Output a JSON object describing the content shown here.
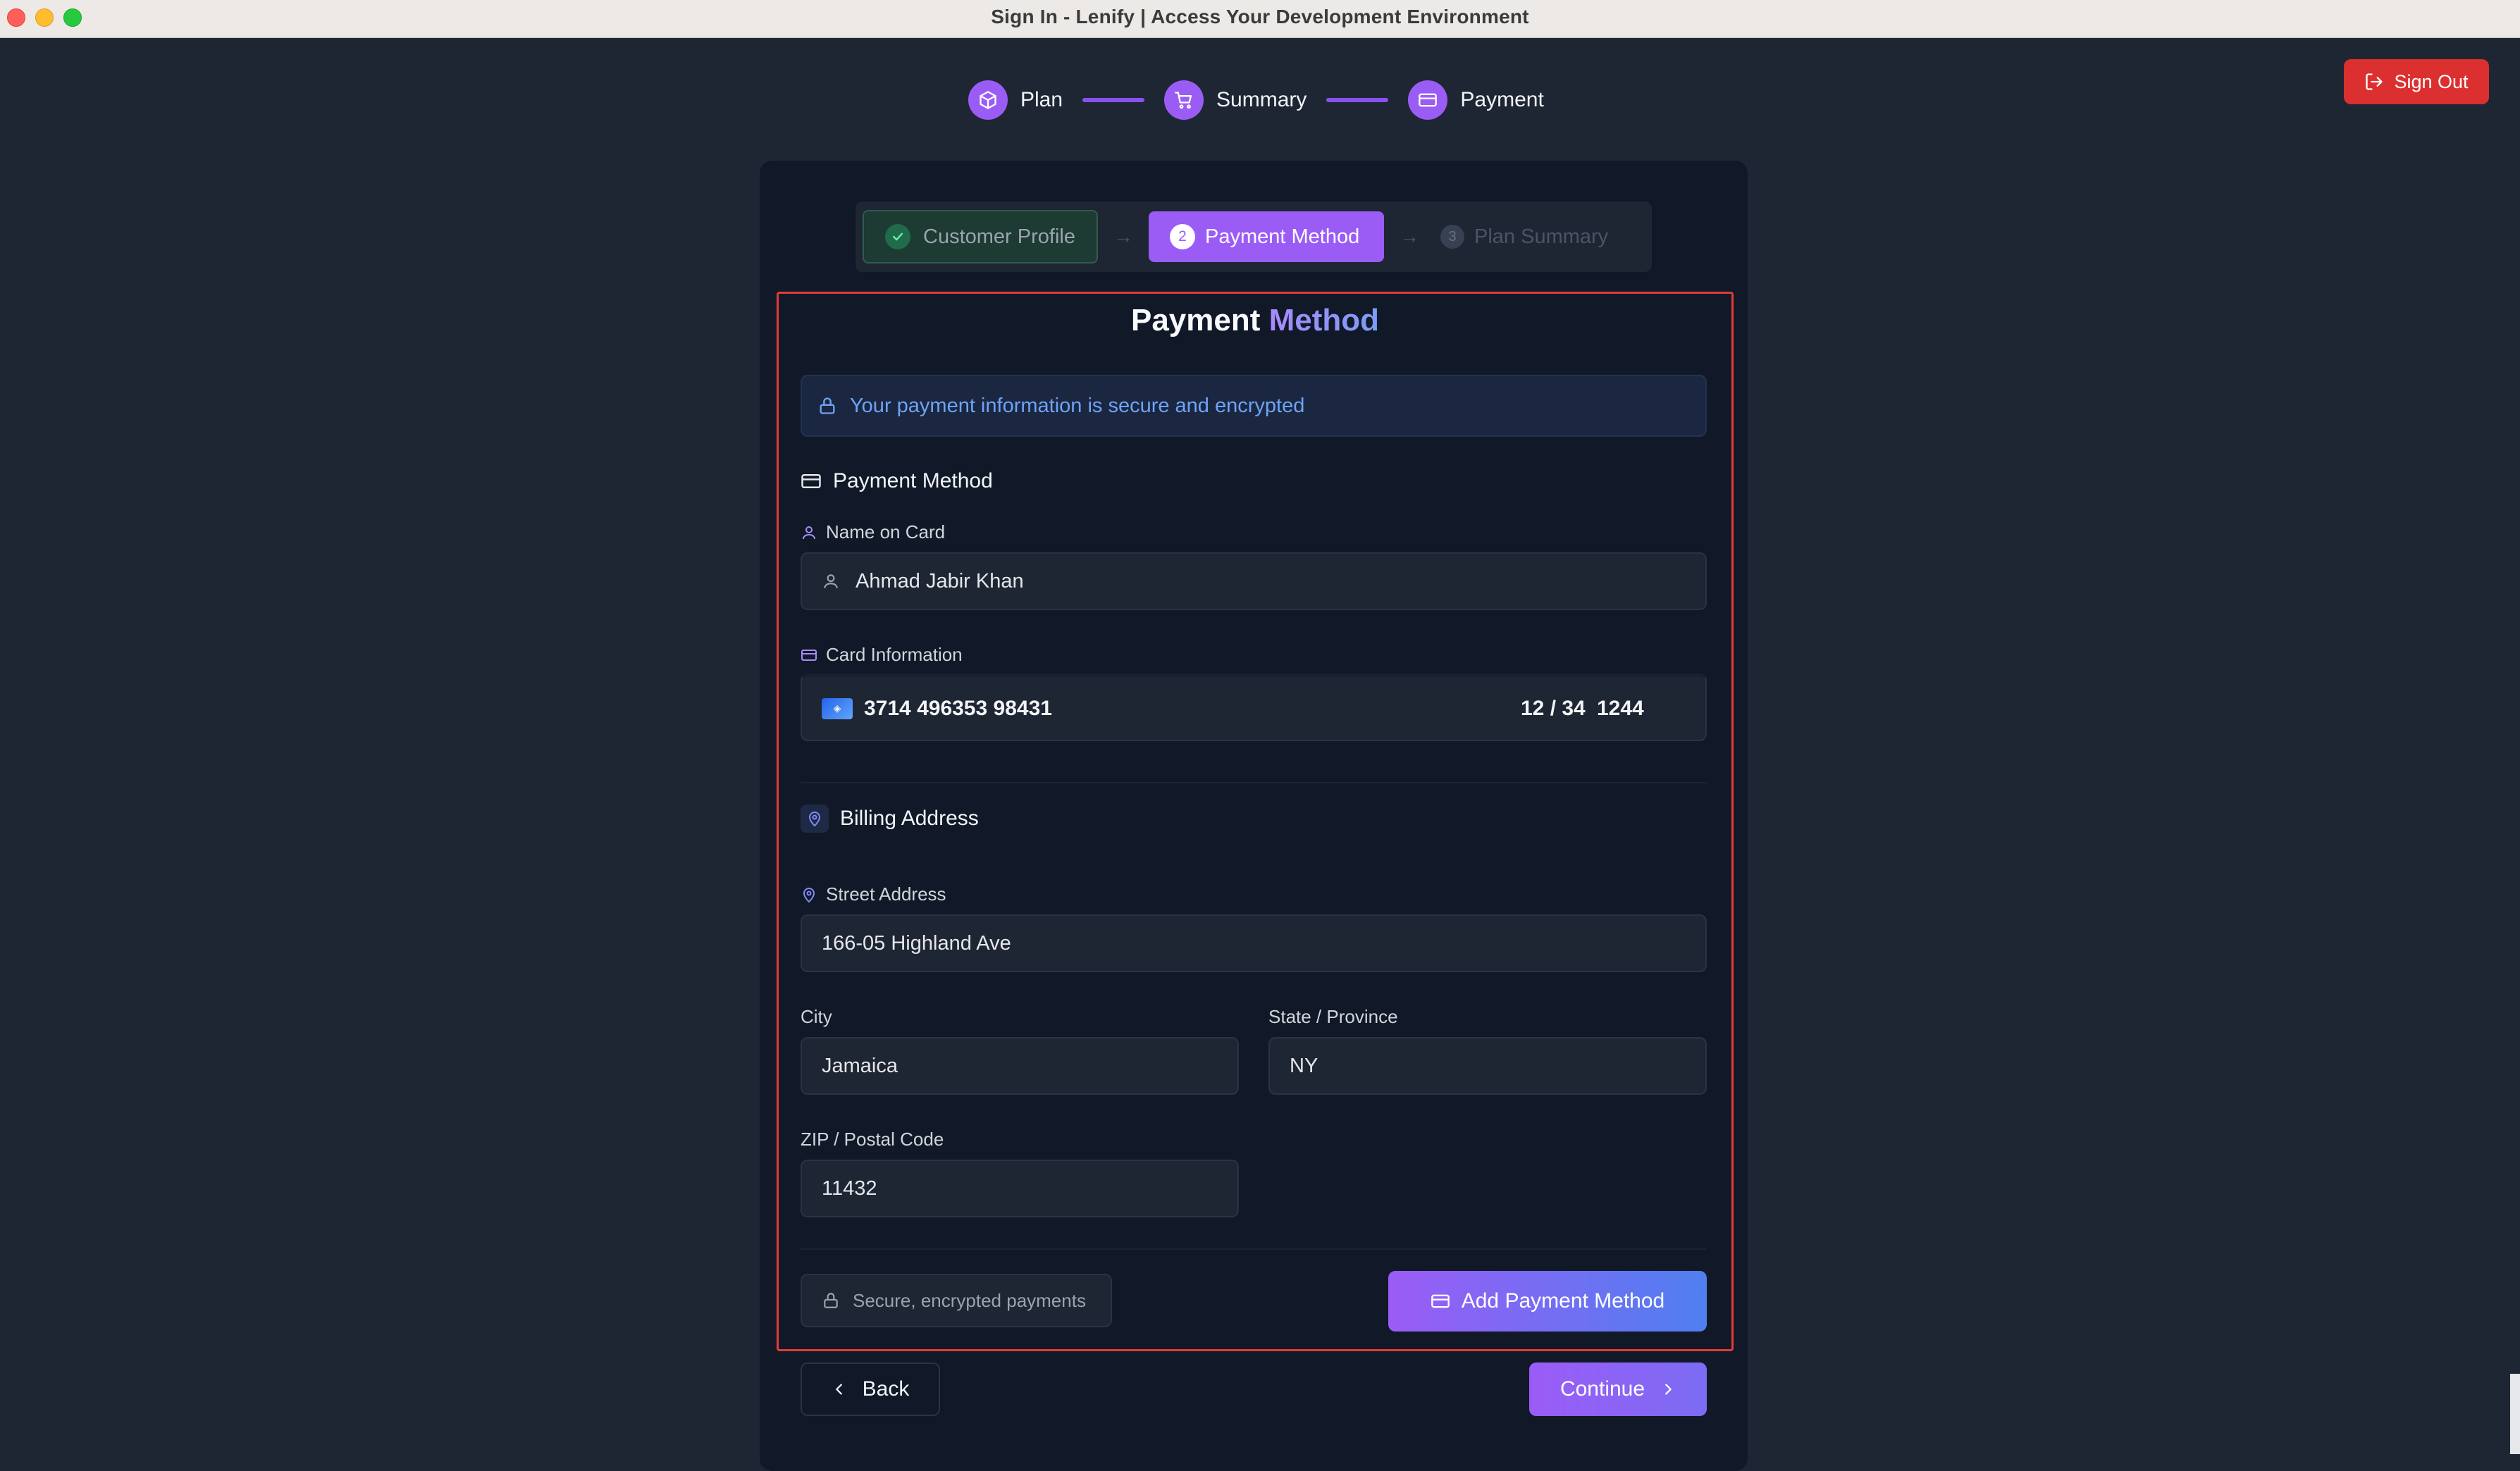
{
  "window": {
    "title": "Sign In - Lenify | Access Your Development Environment"
  },
  "header": {
    "sign_out_label": "Sign Out"
  },
  "top_stepper": {
    "steps": [
      {
        "label": "Plan",
        "icon": "package-icon"
      },
      {
        "label": "Summary",
        "icon": "cart-icon"
      },
      {
        "label": "Payment",
        "icon": "credit-card-icon"
      }
    ]
  },
  "sub_stepper": {
    "completed": {
      "label": "Customer Profile"
    },
    "active": {
      "number": "2",
      "label": "Payment Method"
    },
    "upcoming": {
      "number": "3",
      "label": "Plan Summary"
    }
  },
  "form": {
    "title_main": "Payment",
    "title_accent": "Method",
    "secure_notice": "Your payment information is secure and encrypted",
    "payment_section_label": "Payment Method",
    "name_label": "Name on Card",
    "name_value": "Ahmad Jabir Khan",
    "card_label": "Card Information",
    "card_number": "3714 496353 98431",
    "card_expiry": "12 / 34",
    "card_cvc": "1244",
    "billing_section_label": "Billing Address",
    "street_label": "Street Address",
    "street_value": "166-05 Highland Ave",
    "city_label": "City",
    "city_value": "Jamaica",
    "state_label": "State / Province",
    "state_value": "NY",
    "zip_label": "ZIP / Postal Code",
    "zip_value": "11432",
    "secure_chip": "Secure, encrypted payments",
    "add_button": "Add Payment Method"
  },
  "footer": {
    "back_label": "Back",
    "continue_label": "Continue"
  },
  "colors": {
    "background": "#1f2633",
    "card": "#111827",
    "accent_purple": "#9b5cf6",
    "accent_blue": "#4f7ff0",
    "danger": "#dc2f2f",
    "highlight_border": "#e23b3b"
  }
}
